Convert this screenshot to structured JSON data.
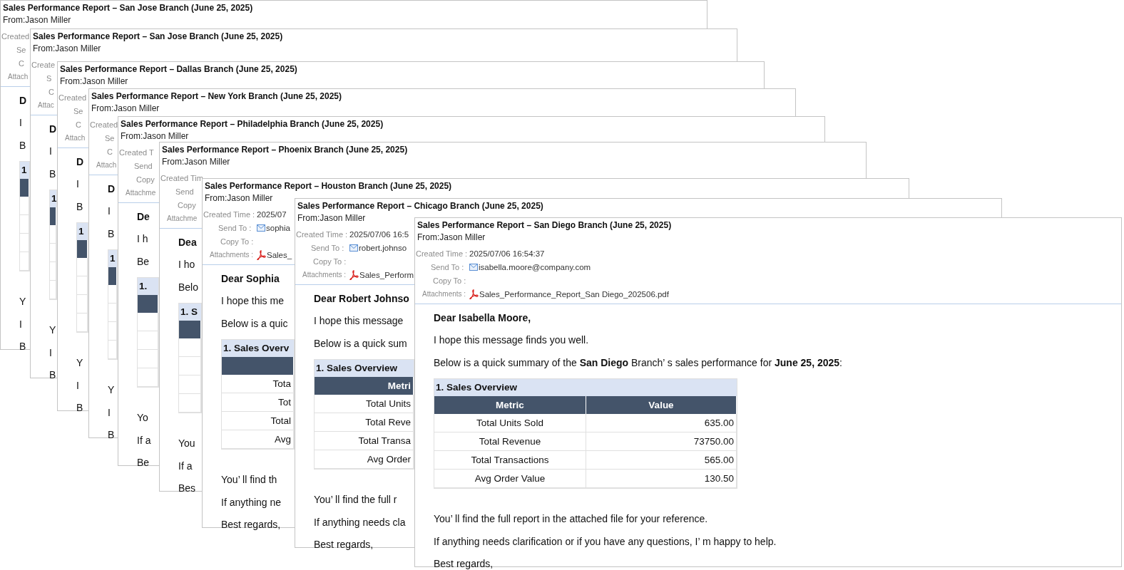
{
  "emails": [
    {
      "subject": "Sales Performance Report – San Jose Branch (June 25, 2025)",
      "from": "From:Jason Miller",
      "fields": [
        {
          "kind": "created",
          "label": "Created"
        },
        {
          "kind": "send",
          "label": "Se"
        },
        {
          "kind": "copy",
          "label": "C"
        },
        {
          "kind": "attach",
          "label": "Attach"
        }
      ],
      "greeting": "D",
      "intro": "I",
      "summary": "B",
      "table": {
        "title": "1"
      },
      "closing": "Y",
      "help": "I",
      "signoff": "B"
    },
    {
      "subject": "Sales Performance Report – San Jose Branch (June 25, 2025)",
      "from": "From:Jason Miller",
      "fields": [
        {
          "kind": "created",
          "label": "Create"
        },
        {
          "kind": "send",
          "label": "S"
        },
        {
          "kind": "copy",
          "label": "C"
        },
        {
          "kind": "attach",
          "label": "Attac"
        }
      ],
      "greeting": "D",
      "intro": "I",
      "summary": "B",
      "table": {
        "title": "1"
      },
      "closing": "Y",
      "help": "I",
      "signoff": "B"
    },
    {
      "subject": "Sales Performance Report – Dallas Branch (June 25, 2025)",
      "from": "From:Jason Miller",
      "fields": [
        {
          "kind": "created",
          "label": "Created"
        },
        {
          "kind": "send",
          "label": "Se"
        },
        {
          "kind": "copy",
          "label": "C"
        },
        {
          "kind": "attach",
          "label": "Attach"
        }
      ],
      "greeting": "D",
      "intro": "I",
      "summary": "B",
      "table": {
        "title": "1"
      },
      "closing": "Y",
      "help": "I",
      "signoff": "B"
    },
    {
      "subject": "Sales Performance Report – New York Branch (June 25, 2025)",
      "from": "From:Jason Miller",
      "fields": [
        {
          "kind": "created",
          "label": "Created"
        },
        {
          "kind": "send",
          "label": "Se"
        },
        {
          "kind": "copy",
          "label": "C"
        },
        {
          "kind": "attach",
          "label": "Attach"
        }
      ],
      "greeting": "D",
      "intro": "I",
      "summary": "B",
      "table": {
        "title": "1"
      },
      "closing": "Y",
      "help": "I",
      "signoff": "B"
    },
    {
      "subject": "Sales Performance Report – Philadelphia Branch (June 25, 2025)",
      "from": "From:Jason Miller",
      "fields": [
        {
          "kind": "created",
          "label": "Created T"
        },
        {
          "kind": "send",
          "label": "Send"
        },
        {
          "kind": "copy",
          "label": "Copy"
        },
        {
          "kind": "attach",
          "label": "Attachme"
        }
      ],
      "greeting": "De",
      "intro": "I h",
      "summary": "Be",
      "table": {
        "title": "1."
      },
      "closing": "Yo",
      "help": "If a",
      "signoff": "Be"
    },
    {
      "subject": "Sales Performance Report – Phoenix Branch (June 25, 2025)",
      "from": "From:Jason Miller",
      "fields": [
        {
          "kind": "created",
          "label": "Created Tim"
        },
        {
          "kind": "send",
          "label": "Send"
        },
        {
          "kind": "copy",
          "label": "Copy"
        },
        {
          "kind": "attach",
          "label": "Attachme"
        }
      ],
      "greeting": "Dea",
      "intro": "I ho",
      "summary": "Belo",
      "table": {
        "title": "1. S"
      },
      "closing": "You",
      "help": "If a",
      "signoff": "Bes"
    },
    {
      "subject": "Sales Performance Report – Houston Branch (June 25, 2025)",
      "from": "From:Jason Miller",
      "fields": [
        {
          "kind": "created",
          "label": "Created Time :",
          "value": "2025/07"
        },
        {
          "kind": "send",
          "label": "Send To :",
          "value": "sophia"
        },
        {
          "kind": "copy",
          "label": "Copy To :"
        },
        {
          "kind": "attach",
          "label": "Attachments :",
          "value": "Sales_"
        }
      ],
      "greeting": "Dear Sophia",
      "intro": "I hope this me",
      "summary": "Below is a quic",
      "table": {
        "title": "1. Sales Overv",
        "rows": [
          {
            "metric": "Tota"
          },
          {
            "metric": "Tot"
          },
          {
            "metric": "Total"
          },
          {
            "metric": "Avg"
          }
        ]
      },
      "closing": "You’ ll find th",
      "help": "If anything ne",
      "signoff": "Best regards,"
    },
    {
      "subject": "Sales Performance Report – Chicago Branch (June 25, 2025)",
      "from": "From:Jason Miller",
      "fields": [
        {
          "kind": "created",
          "label": "Created Time :",
          "value": "2025/07/06 16:5"
        },
        {
          "kind": "send",
          "label": "Send To :",
          "value": "robert.johnso"
        },
        {
          "kind": "copy",
          "label": "Copy To :"
        },
        {
          "kind": "attach",
          "label": "Attachments :",
          "value": "Sales_Perform"
        }
      ],
      "greeting": "Dear Robert Johnso",
      "intro": "I hope this message",
      "summary": "Below is a quick sum",
      "table": {
        "title": "1. Sales Overview",
        "columns": [
          "Metri"
        ],
        "rows": [
          {
            "metric": "Total Units"
          },
          {
            "metric": "Total Reve"
          },
          {
            "metric": "Total Transa"
          },
          {
            "metric": "Avg Order"
          }
        ]
      },
      "closing": "You’ ll find the full r",
      "help": "If anything needs cla",
      "signoff": "Best regards,"
    },
    {
      "subject": "Sales Performance Report – San Diego Branch (June 25, 2025)",
      "from": "From:Jason Miller",
      "fields": [
        {
          "kind": "created",
          "label": "Created Time :",
          "value": "2025/07/06 16:54:37"
        },
        {
          "kind": "send",
          "label": "Send To :",
          "value": "isabella.moore@company.com"
        },
        {
          "kind": "copy",
          "label": "Copy To :"
        },
        {
          "kind": "attach",
          "label": "Attachments :",
          "value": "Sales_Performance_Report_San Diego_202506.pdf"
        }
      ],
      "greeting": "Dear Isabella Moore,",
      "intro": "I hope this message finds you well.",
      "summary": "Below is a quick summary of the **San Diego** Branch’ s sales performance for **June 25, 2025**:",
      "table": {
        "title": "1. Sales Overview",
        "columns": [
          "Metric",
          "Value"
        ],
        "rows": [
          {
            "metric": "Total Units Sold",
            "value": "635.00"
          },
          {
            "metric": "Total Revenue",
            "value": "73750.00"
          },
          {
            "metric": "Total Transactions",
            "value": "565.00"
          },
          {
            "metric": "Avg Order Value",
            "value": "130.50"
          }
        ]
      },
      "closing": "You’ ll find the full report in the attached file for your reference.",
      "help": "If anything needs clarification or if you have any questions, I’ m happy to help.",
      "signoff": "Best regards,"
    }
  ]
}
